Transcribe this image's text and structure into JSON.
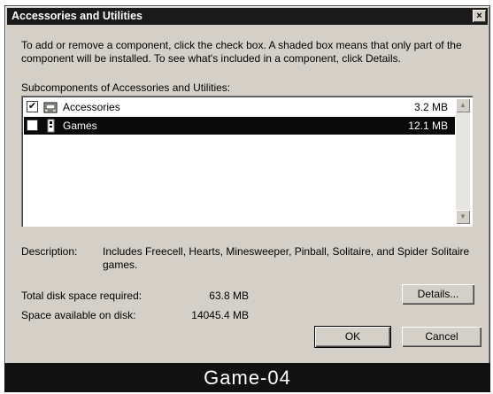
{
  "window": {
    "title": "Accessories and Utilities",
    "close_glyph": "×"
  },
  "intro_text": "To add or remove a component, click the check box. A shaded box means that only part of the component will be installed. To see what's included in a component, click Details.",
  "subcomponents_label": "Subcomponents of Accessories and Utilities:",
  "components": [
    {
      "name": "Accessories",
      "size": "3.2 MB",
      "checked": true,
      "selected": false,
      "icon": "accessories-icon"
    },
    {
      "name": "Games",
      "size": "12.1 MB",
      "checked": false,
      "selected": true,
      "icon": "games-icon"
    }
  ],
  "scrollbar": {
    "up_glyph": "▲",
    "down_glyph": "▼"
  },
  "description": {
    "label": "Description:",
    "text": "Includes Freecell, Hearts, Minesweeper, Pinball, Solitaire, and Spider Solitaire games."
  },
  "disk": {
    "required_label": "Total disk space required:",
    "required_value": "63.8 MB",
    "available_label": "Space available on disk:",
    "available_value": "14045.4 MB"
  },
  "buttons": {
    "details": "Details...",
    "ok": "OK",
    "cancel": "Cancel"
  },
  "caption": "Game-04",
  "colors": {
    "dialog_bg": "#d4d0c8",
    "titlebar": "#1a1a1a",
    "selection": "#0a0a0a"
  }
}
